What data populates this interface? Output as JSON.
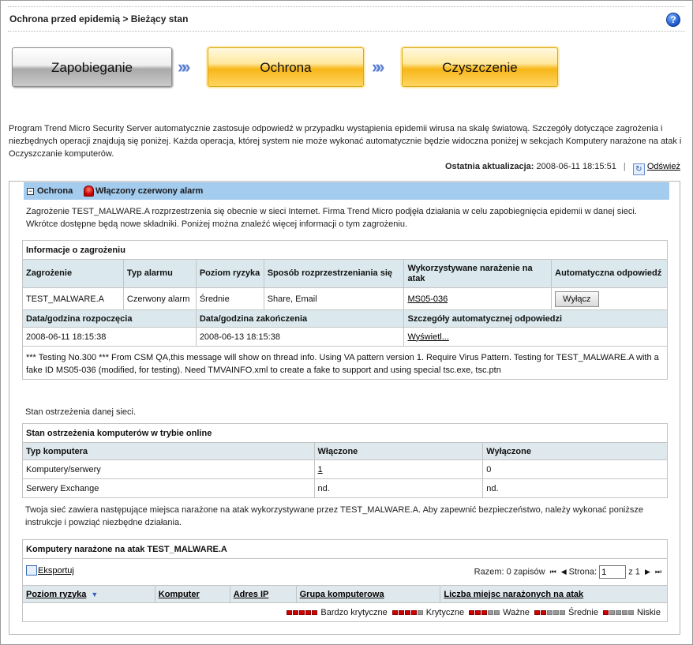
{
  "header": {
    "title": "Ochrona przed epidemią > Bieżący stan",
    "help_glyph": "?"
  },
  "steps": {
    "prevention": "Zapobieganie",
    "protection": "Ochrona",
    "cleanup": "Czyszczenie",
    "arrow_glyph": "»»"
  },
  "intro": "Program Trend Micro Security Server automatycznie zastosuje odpowiedź w przypadku wystąpienia epidemii wirusa na skalę światową. Szczegóły dotyczące zagrożenia i niezbędnych operacji znajdują się poniżej. Każda operacja, której system nie może wykonać automatycznie będzie widoczna poniżej w sekcjach Komputery narażone na atak i Oczyszczanie komputerów.",
  "update": {
    "label": "Ostatnia aktualizacja:",
    "value": "2008-06-11 18:15:51",
    "separator": "|",
    "refresh": "Odśwież"
  },
  "panel": {
    "title": "Ochrona",
    "alarm": "Włączony czerwony alarm",
    "description": "Zagrożenie TEST_MALWARE.A rozprzestrzenia się obecnie w sieci Internet. Firma Trend Micro podjęła działania w celu zapobiegnięcia epidemii w danej sieci. Wkrótce dostępne będą nowe składniki. Poniżej można znaleźć więcej informacji o tym zagrożeniu."
  },
  "threat": {
    "section": "Informacje o zagrożeniu",
    "headers": [
      "Zagrożenie",
      "Typ alarmu",
      "Poziom ryzyka",
      "Sposób rozprzestrzeniania się",
      "Wykorzystywane narażenie na atak",
      "Automatyczna odpowiedź"
    ],
    "values": {
      "name": "TEST_MALWARE.A",
      "alarm_type": "Czerwony alarm",
      "risk": "Średnie",
      "spread": "Share, Email",
      "vulnerability": "MS05-036",
      "disable_button": "Wyłącz"
    },
    "headers2": [
      "Data/godzina rozpoczęcia",
      "Data/godzina zakończenia",
      "Szczegóły automatycznej odpowiedzi"
    ],
    "start": "2008-06-11 18:15:38",
    "end": "2008-06-13 18:15:38",
    "details_link": "Wyświetl...",
    "note": "*** Testing No.300 *** From CSM QA,this message will show on thread info. Using VA pattern version 1. Require Virus Pattern. Testing for TEST_MALWARE.A with a fake ID MS05-036 (modified, for testing). Need TMVAINFO.xml to create a fake to support and using special tsc.exe, tsc.ptn"
  },
  "network": {
    "caption": "Stan ostrzeżenia danej sieci.",
    "section": "Stan ostrzeżenia komputerów w trybie online",
    "headers": [
      "Typ komputera",
      "Włączone",
      "Wyłączone"
    ],
    "rows": [
      {
        "type": "Komputery/serwery",
        "enabled": "1",
        "disabled": "0"
      },
      {
        "type": "Serwery Exchange",
        "enabled": "nd.",
        "disabled": "nd."
      }
    ]
  },
  "vulnerable": {
    "intro": "Twoja sieć zawiera następujące miejsca narażone na atak wykorzystywane przez TEST_MALWARE.A. Aby zapewnić bezpieczeństwo, należy wykonać poniższe instrukcje i powziąć niezbędne działania.",
    "section": "Komputery narażone na atak TEST_MALWARE.A",
    "export": "Eksportuj",
    "total": "Razem: 0 zapisów",
    "page_label": "Strona:",
    "page_value": "1",
    "page_of": "z 1",
    "pager_first": "⏮",
    "pager_prev": "◀",
    "pager_next": "▶",
    "pager_last": "⏭",
    "sort_glyph": "▼",
    "headers": [
      "Poziom ryzyka",
      "Komputer",
      "Adres IP",
      "Grupa komputerowa",
      "Liczba miejsc narażonych na atak"
    ],
    "legend": [
      {
        "label": "Bardzo krytyczne",
        "level": 5
      },
      {
        "label": "Krytyczne",
        "level": 4
      },
      {
        "label": "Ważne",
        "level": 3
      },
      {
        "label": "Średnie",
        "level": 2
      },
      {
        "label": "Niskie",
        "level": 1
      }
    ]
  }
}
